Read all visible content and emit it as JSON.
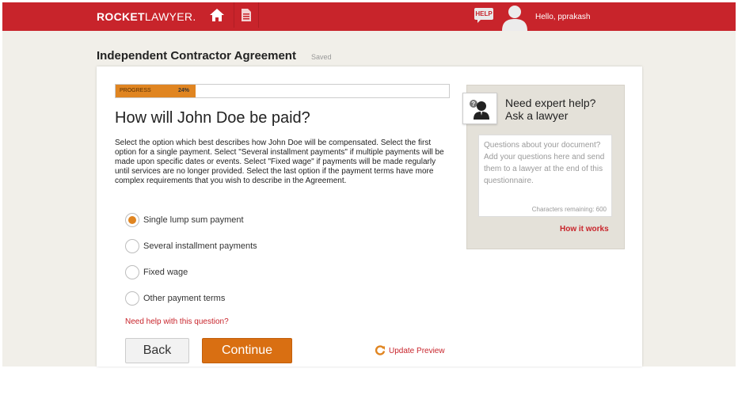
{
  "header": {
    "logo_bold": "ROCKET",
    "logo_light": "LAWYER.",
    "help_badge": "HELP",
    "greeting": "Hello, pprakash"
  },
  "page": {
    "title": "Independent Contractor Agreement",
    "saved_status": "Saved"
  },
  "progress": {
    "label": "PROGRESS",
    "percent_text": "24%",
    "fraction": 0.24
  },
  "question": {
    "title": "How will John Doe be paid?",
    "description": "Select the option which best describes how John Doe will be compensated. Select the first option for a single payment. Select \"Several installment payments\" if multiple payments will be made upon specific dates or events. Select \"Fixed wage\" if payments will be made regularly until services are no longer provided. Select the last option if the payment terms have more complex requirements that you wish to describe in the Agreement.",
    "options": [
      {
        "label": "Single lump sum payment",
        "selected": true
      },
      {
        "label": "Several installment payments",
        "selected": false
      },
      {
        "label": "Fixed wage",
        "selected": false
      },
      {
        "label": "Other payment terms",
        "selected": false
      }
    ],
    "help_link": "Need help with this question?"
  },
  "actions": {
    "back_label": "Back",
    "continue_label": "Continue",
    "update_preview_label": "Update Preview"
  },
  "side_panel": {
    "title_line1": "Need expert help?",
    "title_line2": "Ask a lawyer",
    "placeholder": "Questions about your document? Add your questions here and send them to a lawyer at the end of this questionnaire.",
    "chars_remaining": "Characters remaining: 600",
    "how_it_works": "How it works"
  },
  "colors": {
    "brand_red": "#c8242b",
    "accent_orange": "#e08521",
    "continue_orange": "#d96f12"
  },
  "icons": {
    "home": "home-icon",
    "document": "document-icon",
    "help": "help-bubble-icon",
    "avatar": "user-avatar-icon",
    "expert": "lawyer-icon",
    "refresh": "refresh-icon"
  }
}
